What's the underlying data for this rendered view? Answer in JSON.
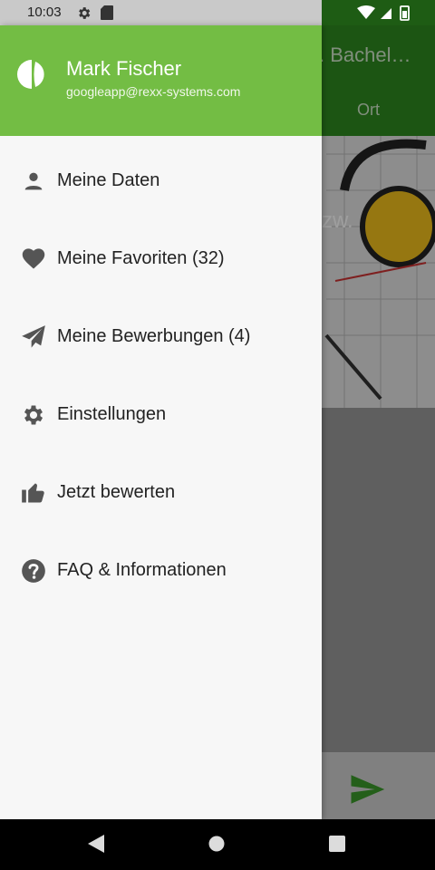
{
  "status_bar": {
    "time": "10:03"
  },
  "background": {
    "title_partial": ". Bachel…",
    "ort_label": "Ort",
    "hero_text_partial": "zw."
  },
  "drawer": {
    "user_name": "Mark Fischer",
    "user_email": "googleapp@rexx-systems.com",
    "items": [
      {
        "label": "Meine Daten",
        "icon": "person-icon"
      },
      {
        "label": "Meine Favoriten (32)",
        "icon": "heart-icon"
      },
      {
        "label": "Meine Bewerbungen (4)",
        "icon": "send-icon"
      },
      {
        "label": "Einstellungen",
        "icon": "gear-icon"
      },
      {
        "label": "Jetzt bewerten",
        "icon": "thumbs-up-icon"
      },
      {
        "label": "FAQ & Informationen",
        "icon": "help-circle-icon"
      }
    ]
  },
  "colors": {
    "drawer_header": "#73bd44",
    "app_header": "#2e8a20",
    "icon_gray": "#555555"
  }
}
